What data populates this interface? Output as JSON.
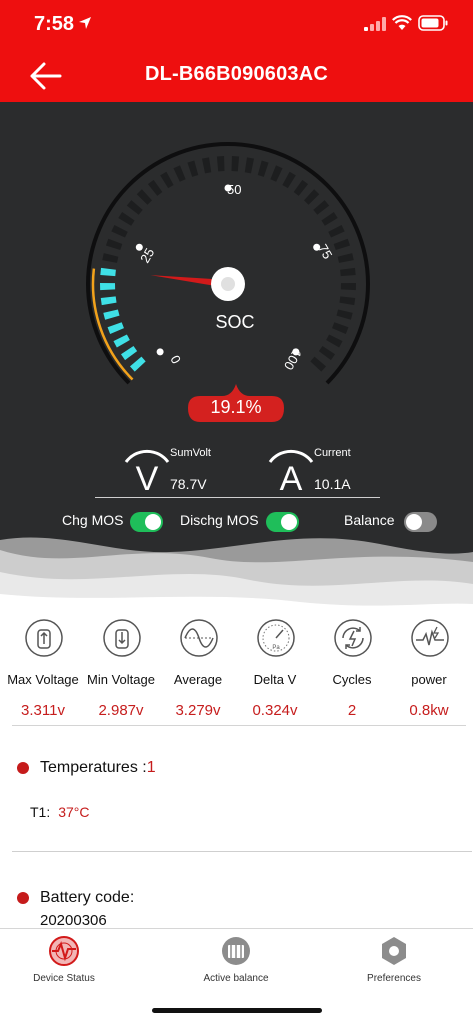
{
  "status_bar": {
    "time": "7:58"
  },
  "header": {
    "title": "DL-B66B090603AC"
  },
  "gauge": {
    "label": "SOC",
    "soc_value": "19.1%",
    "soc_percent": 19.1,
    "ticks": [
      "0",
      "25",
      "50",
      "75",
      "100"
    ],
    "colors": {
      "active_segment": "#3fe0e6",
      "inactive_segment": "#1d1e1f",
      "arc_accent": "#f2a21b",
      "needle": "#d21a1a",
      "badge": "#d4211f"
    }
  },
  "sum_volt": {
    "icon_letter": "V",
    "label": "SumVolt",
    "value": "78.7V"
  },
  "current": {
    "icon_letter": "A",
    "label": "Current",
    "value": "10.1A"
  },
  "switches": [
    {
      "label": "Chg MOS",
      "on": true
    },
    {
      "label": "Dischg MOS",
      "on": true
    },
    {
      "label": "Balance",
      "on": false
    }
  ],
  "stats": [
    {
      "icon": "max-voltage-icon",
      "label": "Max Voltage",
      "value": "3.311v"
    },
    {
      "icon": "min-voltage-icon",
      "label": "Min Voltage",
      "value": "2.987v"
    },
    {
      "icon": "average-wave-icon",
      "label": "Average",
      "value": "3.279v"
    },
    {
      "icon": "delta-gauge-icon",
      "label": "Delta V",
      "value": "0.324v"
    },
    {
      "icon": "cycles-icon",
      "label": "Cycles",
      "value": "2"
    },
    {
      "icon": "power-icon",
      "label": "power",
      "value": "0.8kw"
    }
  ],
  "temperatures": {
    "title": "Temperatures :",
    "count": "1",
    "items": [
      {
        "label": "T1:",
        "value": "37°C"
      }
    ]
  },
  "battery_code": {
    "title": "Battery code:",
    "value": "20200306"
  },
  "tabs": [
    {
      "label": "Device Status",
      "icon": "device-status-icon"
    },
    {
      "label": "Active balance",
      "icon": "active-balance-icon"
    },
    {
      "label": "Preferences",
      "icon": "preferences-icon"
    }
  ],
  "theme": {
    "brand_red": "#ee0f0f",
    "value_red": "#c61d1d",
    "toggle_on": "#1fbe5a"
  }
}
